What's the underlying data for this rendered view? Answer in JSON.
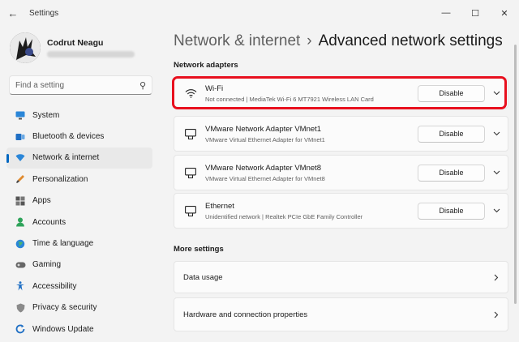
{
  "window": {
    "title": "Settings"
  },
  "profile": {
    "name": "Codrut Neagu"
  },
  "search": {
    "placeholder": "Find a setting"
  },
  "nav": [
    {
      "label": "System",
      "icon": "monitor-icon"
    },
    {
      "label": "Bluetooth & devices",
      "icon": "bluetooth-icon"
    },
    {
      "label": "Network & internet",
      "icon": "wifi-icon",
      "selected": true
    },
    {
      "label": "Personalization",
      "icon": "brush-icon"
    },
    {
      "label": "Apps",
      "icon": "apps-icon"
    },
    {
      "label": "Accounts",
      "icon": "person-icon"
    },
    {
      "label": "Time & language",
      "icon": "globe-icon"
    },
    {
      "label": "Gaming",
      "icon": "gamepad-icon"
    },
    {
      "label": "Accessibility",
      "icon": "accessibility-icon"
    },
    {
      "label": "Privacy & security",
      "icon": "shield-icon"
    },
    {
      "label": "Windows Update",
      "icon": "update-icon"
    }
  ],
  "breadcrumb": {
    "parent": "Network & internet",
    "separator": "›",
    "current": "Advanced network settings"
  },
  "sections": {
    "adapters": "Network adapters",
    "more": "More settings"
  },
  "adapters": [
    {
      "name": "Wi-Fi",
      "desc": "Not connected | MediaTek Wi-Fi 6 MT7921 Wireless LAN Card",
      "button": "Disable",
      "icon": "wifi-icon"
    },
    {
      "name": "VMware Network Adapter VMnet1",
      "desc": "VMware Virtual Ethernet Adapter for VMnet1",
      "button": "Disable",
      "icon": "ethernet-icon"
    },
    {
      "name": "VMware Network Adapter VMnet8",
      "desc": "VMware Virtual Ethernet Adapter for VMnet8",
      "button": "Disable",
      "icon": "ethernet-icon"
    },
    {
      "name": "Ethernet",
      "desc": "Unidentified network | Realtek PCIe GbE Family Controller",
      "button": "Disable",
      "icon": "ethernet-icon"
    }
  ],
  "more_settings": [
    {
      "label": "Data usage"
    },
    {
      "label": "Hardware and connection properties"
    }
  ],
  "colors": {
    "accent": "#0067c0",
    "highlight": "#e8101e"
  }
}
